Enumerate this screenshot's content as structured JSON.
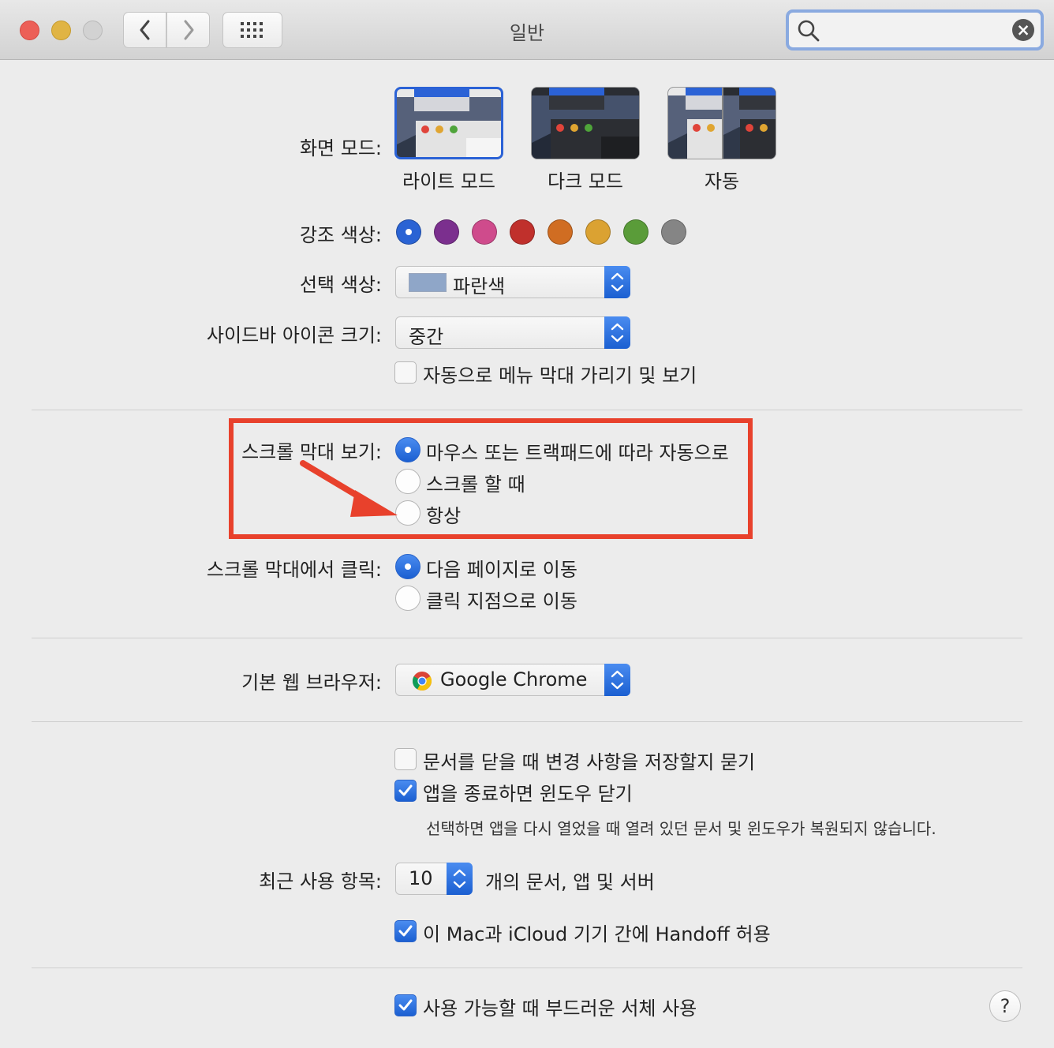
{
  "window": {
    "title": "일반"
  },
  "search": {
    "placeholder": ""
  },
  "appearance": {
    "label": "화면 모드:",
    "modes": [
      {
        "name": "라이트 모드",
        "selected": true
      },
      {
        "name": "다크 모드",
        "selected": false
      },
      {
        "name": "자동",
        "selected": false
      }
    ]
  },
  "accent": {
    "label": "강조 색상:",
    "colors": [
      "#2a63d4",
      "#7b2f8e",
      "#cf4b8c",
      "#c0302c",
      "#d06d22",
      "#dba232",
      "#5a9c39",
      "#858585"
    ],
    "selected_index": 0
  },
  "highlight_color": {
    "label": "선택 색상:",
    "value": "파란색",
    "swatch": "#8fa6c8"
  },
  "sidebar_icon_size": {
    "label": "사이드바 아이콘 크기:",
    "value": "중간"
  },
  "menu_bar": {
    "label": "자동으로 메뉴 막대 가리기 및 보기",
    "checked": false
  },
  "show_scroll_bars": {
    "label": "스크롤 막대 보기:",
    "options": [
      "마우스 또는 트랙패드에 따라 자동으로",
      "스크롤 할 때",
      "항상"
    ],
    "selected_index": 0
  },
  "click_scroll_bar": {
    "label": "스크롤 막대에서 클릭:",
    "options": [
      "다음 페이지로 이동",
      "클릭 지점으로 이동"
    ],
    "selected_index": 0
  },
  "default_browser": {
    "label": "기본 웹 브라우저:",
    "value": "Google Chrome"
  },
  "ask_keep_changes": {
    "label": "문서를 닫을 때 변경 사항을 저장할지 묻기",
    "checked": false
  },
  "close_windows": {
    "label": "앱을 종료하면 윈도우 닫기",
    "checked": true,
    "note": "선택하면 앱을 다시 열었을 때 열려 있던 문서 및 윈도우가 복원되지 않습니다."
  },
  "recent_items": {
    "label": "최근 사용 항목:",
    "value": "10",
    "suffix": "개의 문서, 앱 및 서버"
  },
  "handoff": {
    "label": "이 Mac과 iCloud 기기 간에 Handoff 허용",
    "checked": true
  },
  "font_smoothing": {
    "label": "사용 가능할 때 부드러운 서체 사용",
    "checked": true
  },
  "help": {
    "label": "?"
  },
  "annotation": {
    "color": "#e8412c"
  }
}
